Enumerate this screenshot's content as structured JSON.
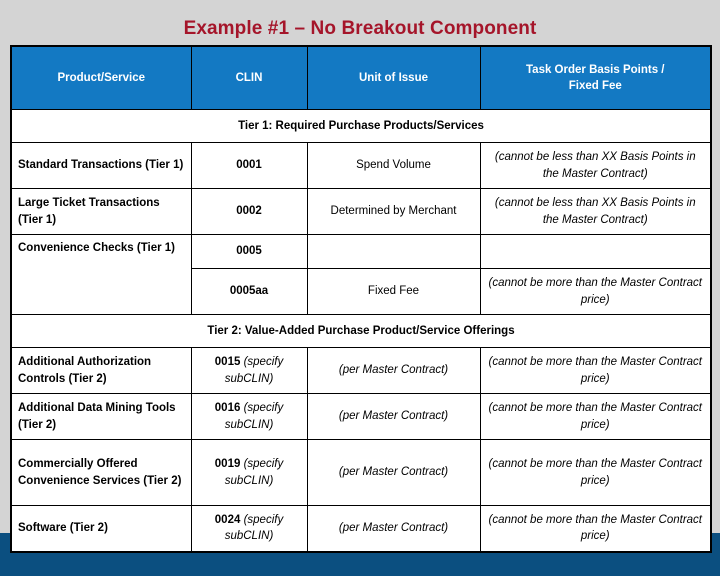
{
  "slide": {
    "title": "Example #1 – No Breakout Component",
    "title_color": "#a5152a",
    "background_color": "#d4d4d4",
    "footer_band_color": "#0b4f80",
    "header_color": "#1379c3",
    "tier1_band_color": "#dce9f7",
    "tier2_band_color": "#e0eeee",
    "disabled_cell_color": "#bfbfbf"
  },
  "table": {
    "columns": [
      {
        "key": "product_service",
        "label": "Product/Service"
      },
      {
        "key": "clin",
        "label": "CLIN"
      },
      {
        "key": "unit_of_issue",
        "label": "Unit of Issue"
      },
      {
        "key": "task_order_basis",
        "label": "Task Order Basis Points / Fixed Fee"
      }
    ],
    "header_col4_line1": "Task Order Basis Points /",
    "header_col4_line2": "Fixed Fee",
    "tier1_band": "Tier 1: Required Purchase Products/Services",
    "tier2_band": "Tier 2: Value-Added Purchase Product/Service Offerings",
    "rows": [
      {
        "product_service": "Standard Transactions (Tier 1)",
        "clin": "0001",
        "clin_note": "",
        "unit_of_issue": "Spend Volume",
        "task_order_basis": "(cannot be less than XX Basis Points in the Master Contract)"
      },
      {
        "product_service": "Large Ticket Transactions (Tier 1)",
        "clin": "0002",
        "clin_note": "",
        "unit_of_issue": "Determined by Merchant",
        "task_order_basis": "(cannot be less than XX Basis Points in the Master Contract)"
      },
      {
        "product_service": "Convenience Checks (Tier 1)",
        "clin": "0005",
        "clin_note": "",
        "unit_of_issue": "",
        "task_order_basis": ""
      },
      {
        "product_service": "",
        "clin": "0005aa",
        "clin_note": "",
        "unit_of_issue": "Fixed Fee",
        "task_order_basis": "(cannot be more than the Master Contract price)"
      },
      {
        "product_service": "Additional Authorization Controls (Tier 2)",
        "clin": "0015",
        "clin_note": "(specify subCLIN)",
        "unit_of_issue": "(per Master Contract)",
        "task_order_basis": "(cannot be more than the Master Contract price)"
      },
      {
        "product_service": "Additional Data Mining Tools (Tier 2)",
        "clin": "0016",
        "clin_note": "(specify subCLIN)",
        "unit_of_issue": "(per Master Contract)",
        "task_order_basis": "(cannot be more than the Master Contract price)"
      },
      {
        "product_service": "Commercially Offered Convenience Services (Tier 2)",
        "clin": "0019",
        "clin_note": "(specify subCLIN)",
        "unit_of_issue": "(per Master Contract)",
        "task_order_basis": "(cannot be more than the Master Contract price)"
      },
      {
        "product_service": "Software (Tier 2)",
        "clin": "0024",
        "clin_note": "(specify subCLIN)",
        "unit_of_issue": "(per Master Contract)",
        "task_order_basis": "(cannot be more than the Master Contract price)"
      }
    ]
  }
}
